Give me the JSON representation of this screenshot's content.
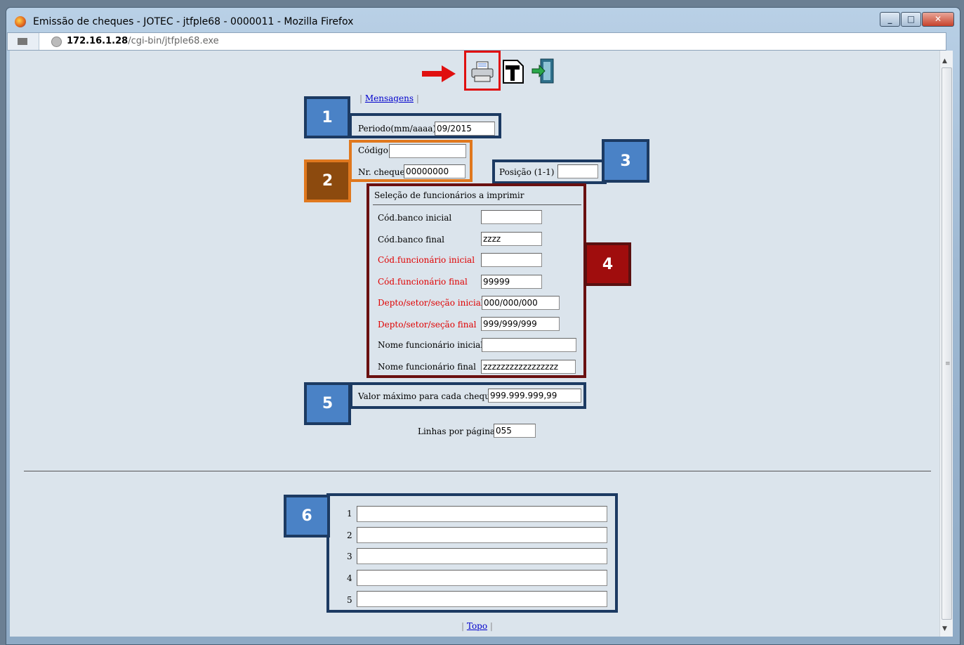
{
  "window": {
    "title": "Emissão de cheques - JOTEC - jtfple68 - 0000011 - Mozilla Firefox",
    "buttons": [
      "minimize",
      "maximize",
      "close"
    ]
  },
  "address": {
    "host": "172.16.1.28",
    "path": "/cgi-bin/jtfple68.exe"
  },
  "toolbar": {
    "icons": [
      "printer-icon",
      "text-report-icon",
      "exit-icon"
    ]
  },
  "nav": {
    "messages_link": "Mensagens",
    "top_link": "Topo",
    "sep": "|"
  },
  "fields": {
    "periodo_label": "Periodo(mm/aaaa)",
    "periodo_value": "09/2015",
    "codigo_label": "Código",
    "codigo_value": "",
    "nr_cheque_label": "Nr. cheque",
    "nr_cheque_value": "00000000",
    "posicao_label": "Posição (1-1)",
    "posicao_value": ""
  },
  "selection": {
    "title": "Seleção de funcionários a imprimir",
    "rows": [
      {
        "label": "Cód.banco inicial",
        "value": ""
      },
      {
        "label": "Cód.banco final",
        "value": "zzzz"
      },
      {
        "label": "Cód.funcionário inicial",
        "value": ""
      },
      {
        "label": "Cód.funcionário final",
        "value": "99999"
      },
      {
        "label": "Depto/setor/seção inicial",
        "value": "000/000/000"
      },
      {
        "label": "Depto/setor/seção final",
        "value": "999/999/999"
      },
      {
        "label": "Nome funcionário inicial",
        "value": ""
      },
      {
        "label": "Nome funcionário final",
        "value": "zzzzzzzzzzzzzzzzz"
      }
    ]
  },
  "valor": {
    "label": "Valor máximo para cada cheque",
    "value": "999.999.999,99"
  },
  "linhas": {
    "label": "Linhas por página",
    "value": "055"
  },
  "lines": {
    "numbers": [
      "1",
      "2",
      "3",
      "4",
      "5"
    ],
    "values": [
      "",
      "",
      "",
      "",
      ""
    ]
  },
  "badges": [
    "1",
    "2",
    "3",
    "4",
    "5",
    "6"
  ],
  "colors": {
    "badge_blue": "#4a82c6",
    "frame_blue": "#1c3a62",
    "orange": "#e0781e",
    "maroon": "#6a1010",
    "highlight_red": "#e01010",
    "required_red": "#e00000"
  }
}
